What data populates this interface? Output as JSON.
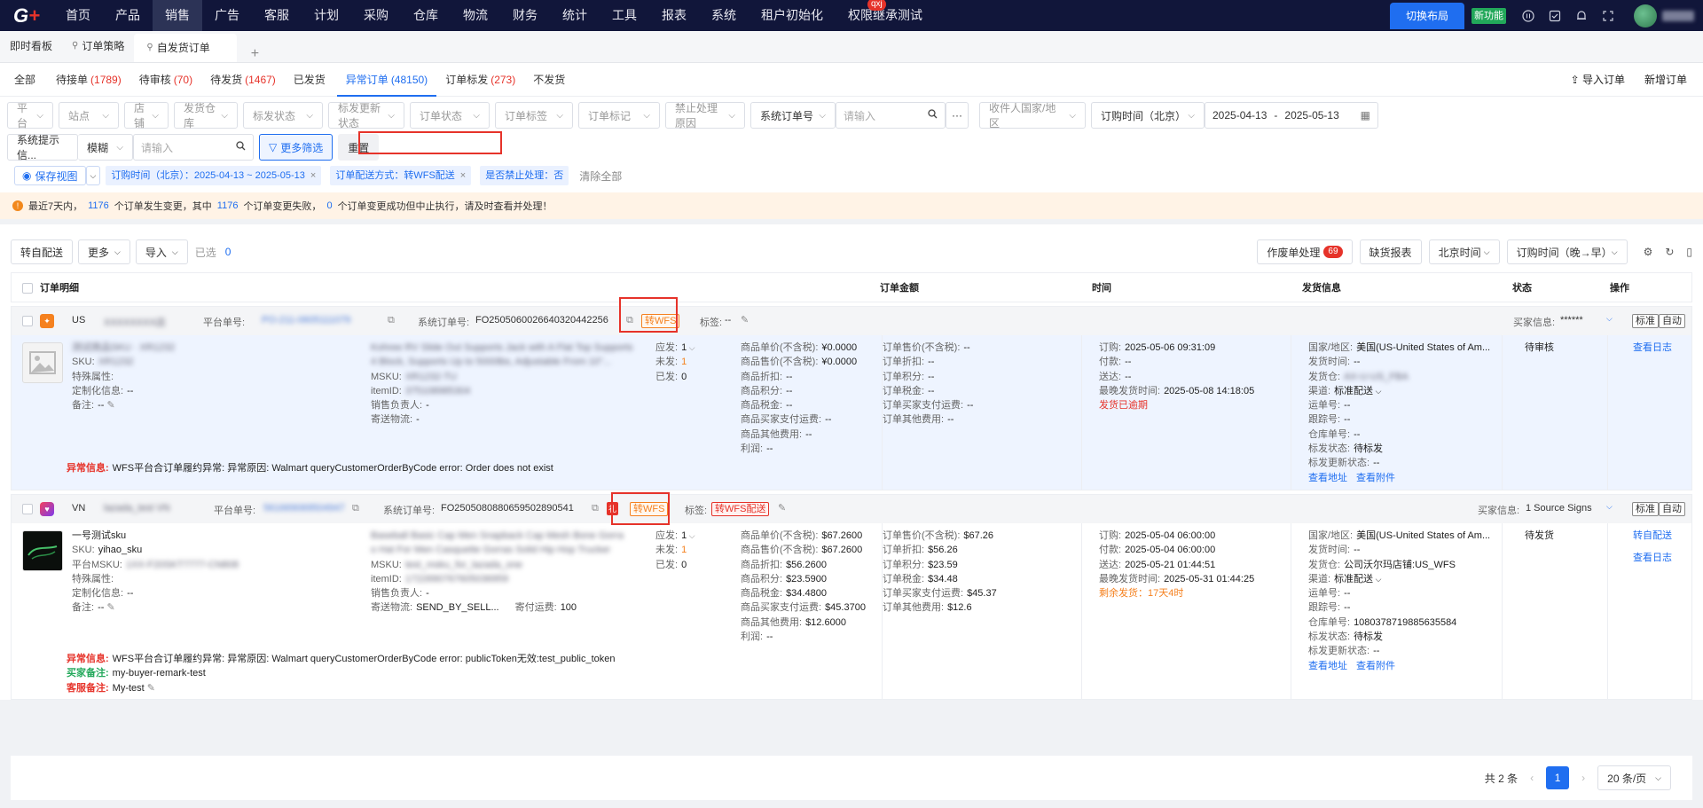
{
  "topnav": {
    "items": [
      "首页",
      "产品",
      "销售",
      "广告",
      "客服",
      "计划",
      "采购",
      "仓库",
      "物流",
      "财务",
      "统计",
      "工具",
      "报表",
      "系统",
      "租户初始化",
      "权限继承测试"
    ],
    "active_index": 2,
    "badge": "qxj",
    "switch_layout": "切换布局",
    "new_feature": "新功能"
  },
  "page_tabs": [
    {
      "label": "即时看板"
    },
    {
      "label": "订单策略"
    },
    {
      "label": "自发货订单"
    }
  ],
  "page_tab_add": "+",
  "status_tabs": [
    {
      "label": "全部",
      "count": ""
    },
    {
      "label": "待接单",
      "count": "(1789)"
    },
    {
      "label": "待审核",
      "count": "(70)"
    },
    {
      "label": "待发货",
      "count": "(1467)"
    },
    {
      "label": "已发货",
      "count": ""
    },
    {
      "label": "异常订单",
      "count": "(48150)"
    },
    {
      "label": "订单标发",
      "count": "(273)"
    },
    {
      "label": "不发货",
      "count": ""
    }
  ],
  "status_active_index": 5,
  "header_actions": {
    "import": "导入订单",
    "new": "新增订单"
  },
  "filters": {
    "row1": [
      "平台",
      "站点",
      "店铺",
      "发货仓库",
      "标发状态",
      "标发更新状态",
      "订单状态",
      "订单标签",
      "订单标记",
      "禁止处理原因"
    ],
    "order_no_select": "系统订单号",
    "order_no_placeholder": "请输入",
    "more_dots": "···",
    "country": "收件人国家/地区",
    "time_select": "订购时间（北京）",
    "date_from": "2025-04-13",
    "date_sep": "-",
    "date_to": "2025-05-13",
    "sys_hint": "系统提示信...",
    "fuzzy": "模糊",
    "search_placeholder": "请输入",
    "more_filter": "更多筛选",
    "reset": "重置"
  },
  "chips": {
    "save_view": "保存视图",
    "items": [
      {
        "text": "订购时间（北京）：2025-04-13 ~ 2025-05-13"
      },
      {
        "text": "订单配送方式：转WFS配送"
      },
      {
        "text": "是否禁止处理：否"
      }
    ],
    "clear_all": "清除全部"
  },
  "warning": {
    "prefix": "最近7天内，",
    "n1": "1176",
    "mid1": "个订单发生变更，其中",
    "n2": "1176",
    "mid2": "个订单变更失败，",
    "n3": "0",
    "suffix": "个订单变更成功但中止执行，请及时查看并处理！"
  },
  "toolbar": {
    "self_ship": "转自配送",
    "more": "更多",
    "import": "导入",
    "selected_label": "已选",
    "selected_count": "0",
    "void_label": "作废单处理",
    "void_count": "69",
    "missing_report": "缺货报表",
    "timezone": "北京时间",
    "sort": "订购时间（晚→早）"
  },
  "table_headers": {
    "detail": "订单明细",
    "amount": "订单金额",
    "time": "时间",
    "shipping": "发货信息",
    "status": "状态",
    "action": "操作"
  },
  "orders": [
    {
      "country": "US",
      "shop": "XXXXXXXX店",
      "platform_no_label": "平台单号:",
      "platform_no": "PO-211-0605111079",
      "sys_no_label": "系统订单号:",
      "sys_no": "FO2505060026640320442256",
      "wfs_tag": "转WFS",
      "tag_label": "标签:",
      "tag_value": "--",
      "buyer_label": "买家信息:",
      "buyer_value": "******",
      "btn_standard": "标准",
      "btn_auto": "自动",
      "product": {
        "name": "测试商品SKU · XR1232",
        "sku_label": "SKU:",
        "sku": "XR1232",
        "special_label": "特殊属性:",
        "custom_label": "定制化信息:",
        "custom": "--",
        "remark_label": "备注:",
        "remark": "--"
      },
      "title": "Kohree RV Slide Out Supports Jack with A Flat Top Supports",
      "title2": "4 Block, Supports Up to 5000lbs, Adjustable From 10\"...",
      "msku_label": "MSKU:",
      "msku": "XR1232-TU",
      "itemid_label": "itemID:",
      "itemid": "375108985304",
      "sales_label": "销售负责人:",
      "sales": "-",
      "logistics_label": "寄送物流:",
      "logistics": "-",
      "qty": [
        {
          "label": "应发:",
          "value": "1"
        },
        {
          "label": "未发:",
          "value": "1"
        },
        {
          "label": "已发:",
          "value": "0"
        }
      ],
      "prices": [
        {
          "label": "商品单价(不含税):",
          "value": "¥0.0000"
        },
        {
          "label": "商品售价(不含税):",
          "value": "¥0.0000"
        },
        {
          "label": "商品折扣:",
          "value": "--"
        },
        {
          "label": "商品积分:",
          "value": "--"
        },
        {
          "label": "商品税金:",
          "value": "--"
        },
        {
          "label": "商品买家支付运费:",
          "value": "--"
        },
        {
          "label": "商品其他费用:",
          "value": "--"
        },
        {
          "label": "利润:",
          "value": "--"
        }
      ],
      "amounts": [
        {
          "label": "订单售价(不含税):",
          "value": "--"
        },
        {
          "label": "订单折扣:",
          "value": "--"
        },
        {
          "label": "订单积分:",
          "value": "--"
        },
        {
          "label": "订单税金:",
          "value": "--"
        },
        {
          "label": "订单买家支付运费:",
          "value": "--"
        },
        {
          "label": "订单其他费用:",
          "value": "--"
        }
      ],
      "times": [
        {
          "label": "订购:",
          "value": "2025-05-06 09:31:09"
        },
        {
          "label": "付款:",
          "value": "--"
        },
        {
          "label": "送达:",
          "value": "--"
        },
        {
          "label": "最晚发货时间:",
          "value": "2025-05-08 14:18:05"
        }
      ],
      "time_alert": "发货已逾期",
      "ship": [
        {
          "label": "国家/地区:",
          "value": "美国(US-United States of Am..."
        },
        {
          "label": "发货时间:",
          "value": "--"
        },
        {
          "label": "发货仓:",
          "value": "AX-U-US_FBA"
        },
        {
          "label": "渠道:",
          "value": "标准配送"
        },
        {
          "label": "运单号:",
          "value": "--"
        },
        {
          "label": "跟踪号:",
          "value": "--"
        },
        {
          "label": "仓库单号:",
          "value": "--"
        },
        {
          "label": "标发状态:",
          "value": "待标发"
        },
        {
          "label": "标发更新状态:",
          "value": "--"
        }
      ],
      "ship_links": [
        "查看地址",
        "查看附件"
      ],
      "status": "待审核",
      "actions": [
        "查看日志"
      ],
      "error_label": "异常信息:",
      "error": "WFS平台合订单履约异常: 异常原因: Walmart queryCustomerOrderByCode error: Order does not exist"
    },
    {
      "country": "VN",
      "shop": "lazada_test VN",
      "platform_no_label": "平台单号:",
      "platform_no": "561669069504947",
      "sys_no_label": "系统订单号:",
      "sys_no": "FO2505080880659502890541",
      "wfs_tag": "转WFS",
      "tag_label": "标签:",
      "tag_value": "转WFS配送",
      "buyer_label": "买家信息:",
      "buyer_value": "1 Source Signs",
      "btn_standard": "标准",
      "btn_auto": "自动",
      "product": {
        "name": "一号测试sku",
        "sku_label": "SKU:",
        "sku": "yihao_sku",
        "msku_label": "平台MSKU:",
        "msku": "1XX-F20SKT7777-CN808",
        "special_label": "特殊属性:",
        "custom_label": "定制化信息:",
        "custom": "--",
        "remark_label": "备注:",
        "remark": "--"
      },
      "title": "Baseball Basic Cap Men Snapback Cap Mesh Bone Gorra",
      "title2": "o Hat For Men Casquette Gorras Solid Hip Hop Trucker",
      "msku_label": "MSKU:",
      "msku": "test_msku_for_lazada_one",
      "itemid_label": "itemID:",
      "itemid": "1722690767605036959",
      "sales_label": "销售负责人:",
      "sales": "-",
      "logistics_label": "寄送物流:",
      "logistics": "SEND_BY_SELL...",
      "postage_label": "寄付运费:",
      "postage": "100",
      "qty": [
        {
          "label": "应发:",
          "value": "1"
        },
        {
          "label": "未发:",
          "value": "1"
        },
        {
          "label": "已发:",
          "value": "0"
        }
      ],
      "prices": [
        {
          "label": "商品单价(不含税):",
          "value": "$67.2600"
        },
        {
          "label": "商品售价(不含税):",
          "value": "$67.2600"
        },
        {
          "label": "商品折扣:",
          "value": "$56.2600"
        },
        {
          "label": "商品积分:",
          "value": "$23.5900"
        },
        {
          "label": "商品税金:",
          "value": "$34.4800"
        },
        {
          "label": "商品买家支付运费:",
          "value": "$45.3700"
        },
        {
          "label": "商品其他费用:",
          "value": "$12.6000"
        },
        {
          "label": "利润:",
          "value": "--"
        }
      ],
      "amounts": [
        {
          "label": "订单售价(不含税):",
          "value": "$67.26"
        },
        {
          "label": "订单折扣:",
          "value": "$56.26"
        },
        {
          "label": "订单积分:",
          "value": "$23.59"
        },
        {
          "label": "订单税金:",
          "value": "$34.48"
        },
        {
          "label": "订单买家支付运费:",
          "value": "$45.37"
        },
        {
          "label": "订单其他费用:",
          "value": "$12.6"
        }
      ],
      "times": [
        {
          "label": "订购:",
          "value": "2025-05-04 06:00:00"
        },
        {
          "label": "付款:",
          "value": "2025-05-04 06:00:00"
        },
        {
          "label": "送达:",
          "value": "2025-05-21 01:44:51"
        },
        {
          "label": "最晚发货时间:",
          "value": "2025-05-31 01:44:25"
        }
      ],
      "time_alert": "剩余发货：17天4时",
      "ship": [
        {
          "label": "国家/地区:",
          "value": "美国(US-United States of Am..."
        },
        {
          "label": "发货时间:",
          "value": "--"
        },
        {
          "label": "发货仓:",
          "value": "公司沃尔玛店铺:US_WFS"
        },
        {
          "label": "渠道:",
          "value": "标准配送"
        },
        {
          "label": "运单号:",
          "value": "--"
        },
        {
          "label": "跟踪号:",
          "value": "--"
        },
        {
          "label": "仓库单号:",
          "value": "1080378719885635584"
        },
        {
          "label": "标发状态:",
          "value": "待标发"
        },
        {
          "label": "标发更新状态:",
          "value": "--"
        }
      ],
      "ship_links": [
        "查看地址",
        "查看附件"
      ],
      "status": "待发货",
      "actions": [
        "转自配送",
        "查看日志"
      ],
      "error_label": "异常信息:",
      "error": "WFS平台合订单履约异常: 异常原因: Walmart queryCustomerOrderByCode error: publicToken无效:test_public_token",
      "buyer_remark_label": "买家备注:",
      "buyer_remark": "my-buyer-remark-test",
      "service_remark_label": "客服备注:",
      "service_remark": "My-test"
    }
  ],
  "pager": {
    "total": "共 2 条",
    "prev": "‹",
    "page": "1",
    "next": "›",
    "size": "20 条/页"
  }
}
